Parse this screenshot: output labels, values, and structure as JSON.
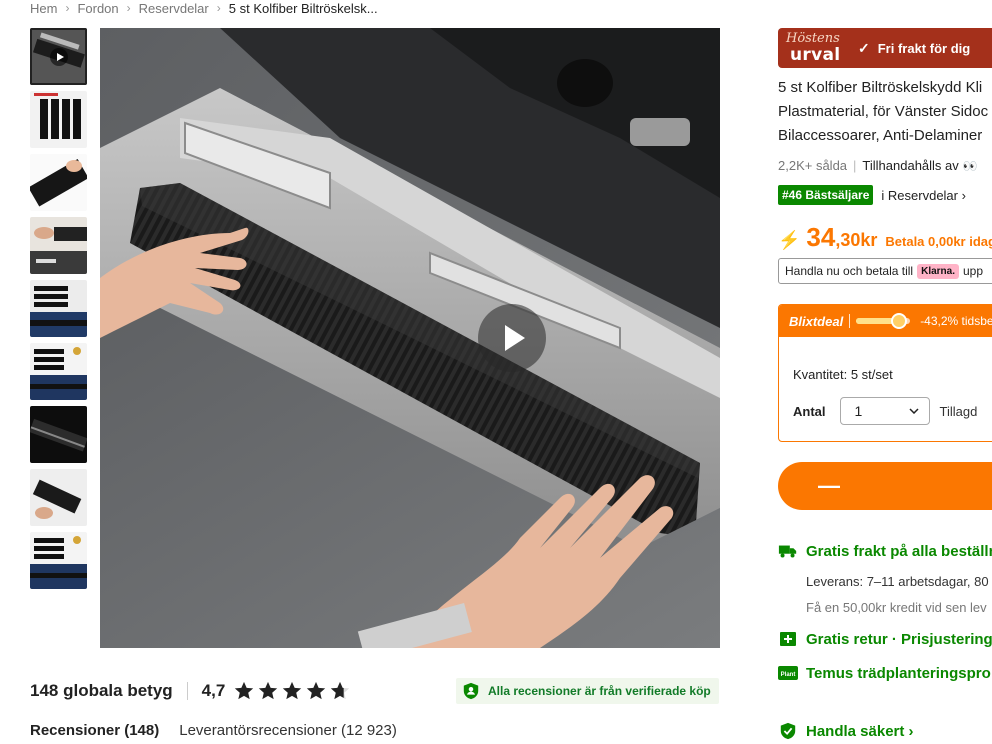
{
  "breadcrumb": [
    "Hem",
    "Fordon",
    "Reservdelar",
    "5 st Kolfiber Biltröskelsk..."
  ],
  "reviews": {
    "count_text": "148 globala betyg",
    "score": "4,7",
    "stars": 4.7,
    "verified_text": "Alla recensioner är från verifierade köp",
    "tab_reviews": "Recensioner (148)",
    "tab_supplier": "Leverantörsrecensioner (12 923)"
  },
  "banner": {
    "logo_line1": "Höstens",
    "logo_line2": "urval",
    "free_shipping": "Fri frakt för dig"
  },
  "product": {
    "title_lines": [
      "5 st Kolfiber Biltröskelskydd Kli",
      "Plastmaterial, för Vänster Sidoc",
      "Bilaccessoarer, Anti-Delaminer"
    ],
    "sold": "2,2K+ sålda",
    "provided_by": "Tillhandahålls av",
    "bestseller_tag": "#46 Bästsäljare",
    "bestseller_category": "i Reservdelar ›",
    "price_main": "34",
    "price_decimal": ",30kr",
    "pay_now": "Betala 0,00kr idag",
    "klarna_text": "Handla nu och betala till",
    "klarna_logo": "Klarna.",
    "klarna_tail": "upp"
  },
  "deal": {
    "label": "Blixtdeal",
    "discount": "-43,2% tidsbe",
    "progress_percent": 80,
    "quantity_label": "Kvantitet:",
    "quantity_value": "5 st/set",
    "amount_label": "Antal",
    "amount_value": "1",
    "added_text": "Tillagd"
  },
  "cart_symbol": "—",
  "shipping": {
    "free": "Gratis frakt på alla beställn",
    "delivery": "Leverans: 7–11 arbetsdagar, 80",
    "credit": "Få en 50,00kr kredit vid sen lev",
    "returns": "Gratis retur · Prisjustering",
    "tree": "Temus trädplanteringspro",
    "plant_badge": "Plant",
    "safe": "Handla säkert ›"
  },
  "colors": {
    "accent": "#fb7701",
    "green": "#0a8800",
    "banner": "#a4301b"
  }
}
